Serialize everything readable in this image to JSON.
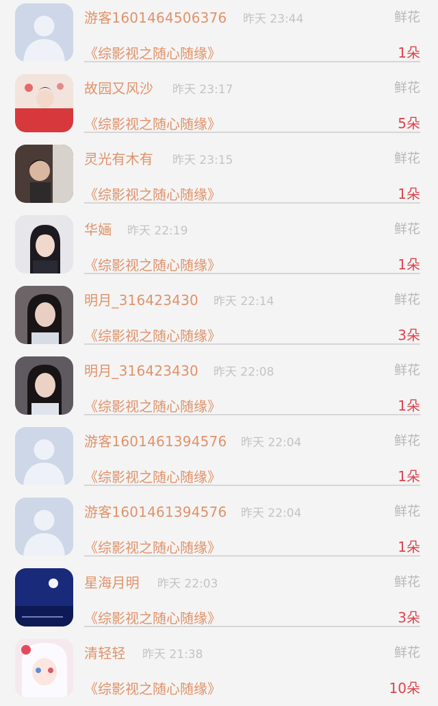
{
  "gift_label": "鲜花",
  "work_title": "《综影视之随心随缘》",
  "colors": {
    "name": "#e0926a",
    "count": "#e0424a",
    "time": "#c3c3c3",
    "gift": "#b8b8b8"
  },
  "items": [
    {
      "name": "游客1601464506376",
      "time": "昨天 23:44",
      "count": "1朵",
      "avatar": "default-avatar-icon"
    },
    {
      "name": "故园又风沙",
      "time": "昨天 23:17",
      "count": "5朵",
      "avatar": "user-avatar"
    },
    {
      "name": "灵光有木有",
      "time": "昨天 23:15",
      "count": "1朵",
      "avatar": "user-avatar"
    },
    {
      "name": "华婳",
      "time": "昨天 22:19",
      "count": "1朵",
      "avatar": "user-avatar"
    },
    {
      "name": "明月_316423430",
      "time": "昨天 22:14",
      "count": "3朵",
      "avatar": "user-avatar"
    },
    {
      "name": "明月_316423430",
      "time": "昨天 22:08",
      "count": "1朵",
      "avatar": "user-avatar"
    },
    {
      "name": "游客1601461394576",
      "time": "昨天 22:04",
      "count": "1朵",
      "avatar": "default-avatar-icon"
    },
    {
      "name": "游客1601461394576",
      "time": "昨天 22:04",
      "count": "1朵",
      "avatar": "default-avatar-icon"
    },
    {
      "name": "星海月明",
      "time": "昨天 22:03",
      "count": "3朵",
      "avatar": "user-avatar"
    },
    {
      "name": "清轻轻",
      "time": "昨天 21:38",
      "count": "10朵",
      "avatar": "user-avatar"
    }
  ]
}
